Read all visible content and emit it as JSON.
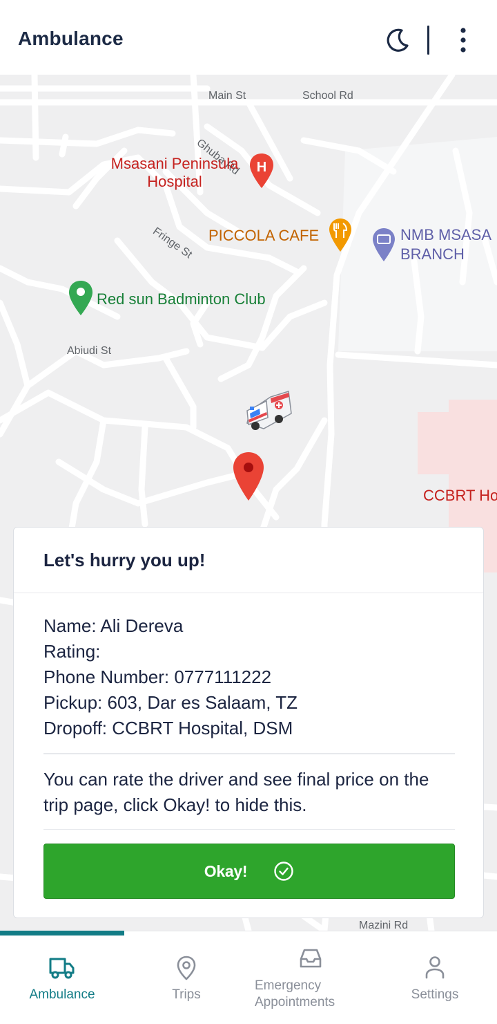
{
  "header": {
    "title": "Ambulance"
  },
  "map": {
    "streets": [
      "Main St",
      "School Rd",
      "Ghuba Rd",
      "Fringe St",
      "Abiudi St",
      "Mazini Rd"
    ],
    "pois": {
      "hospital_line1": "Msasani Peninsula",
      "hospital_line2": "Hospital",
      "cafe": "PICCOLA CAFE",
      "bank_line1": "NMB MSASA",
      "bank_line2": "BRANCH",
      "club": "Red sun Badminton Club",
      "ccbrt": "CCBRT Ho"
    }
  },
  "card": {
    "heading": "Let's hurry you up!",
    "name": "Name: Ali Dereva",
    "rating": "Rating:",
    "phone": "Phone Number: 0777111222",
    "pickup": "Pickup: 603, Dar es Salaam, TZ",
    "dropoff": "Dropoff: CCBRT Hospital, DSM",
    "note": "You can rate the driver and see final price on the trip page, click Okay! to hide this.",
    "button_label": "Okay!"
  },
  "tabs": [
    {
      "label": "Ambulance",
      "icon": "truck-icon",
      "active": true
    },
    {
      "label": "Trips",
      "icon": "map-pin-icon",
      "active": false
    },
    {
      "label_line1": "Emergency",
      "label_line2": "Appointments",
      "icon": "inbox-icon",
      "active": false
    },
    {
      "label": "Settings",
      "icon": "user-icon",
      "active": false
    }
  ],
  "colors": {
    "accent": "#127c86",
    "ok_button": "#2ea52c",
    "pin": "#ea4335"
  }
}
